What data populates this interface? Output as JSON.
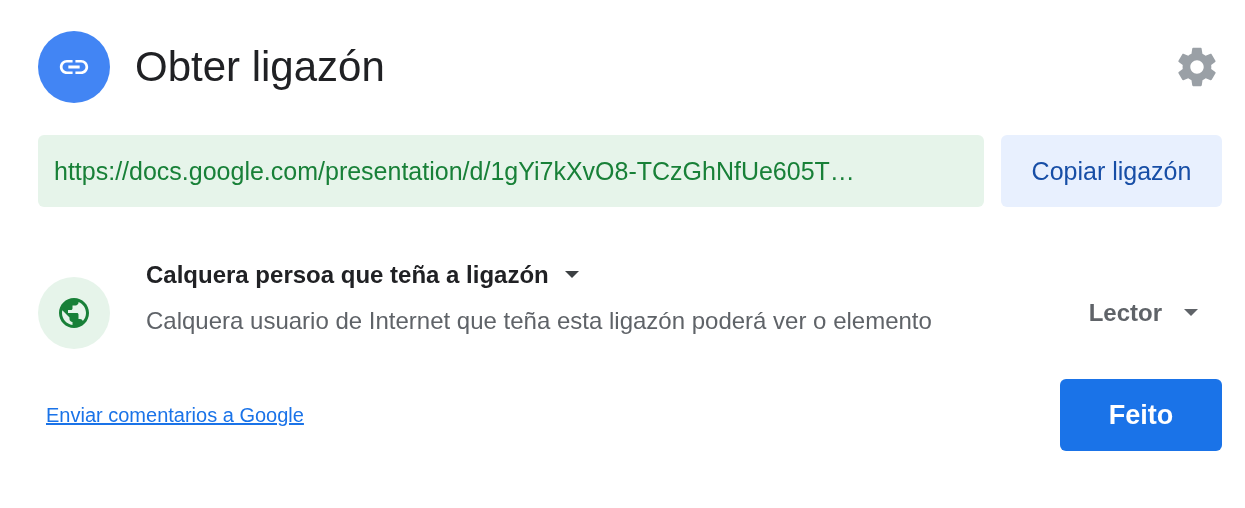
{
  "title": "Obter ligazón",
  "link": {
    "value": "https://docs.google.com/presentation/d/1gYi7kXvO8-TCzGhNfUe605T…",
    "copy_button": "Copiar ligazón"
  },
  "access": {
    "scope": "Calquera persoa que teña a ligazón",
    "description": "Calquera usuario de Internet que teña esta ligazón poderá ver o elemento",
    "role": "Lector"
  },
  "feedback_link": "Enviar comentarios a Google",
  "done_button": "Feito"
}
